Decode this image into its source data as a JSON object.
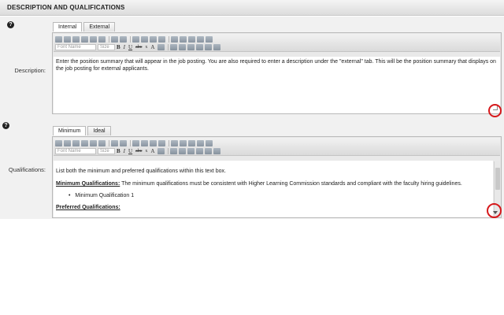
{
  "section": {
    "title": "DESCRIPTION AND QUALIFICATIONS"
  },
  "description": {
    "label": "Description:",
    "help": "?",
    "tabs": [
      "Internal",
      "External"
    ],
    "text": "Enter the position summary that will appear in the job posting. You are also required to enter a description under the \"external\" tab. This will be the position summary that displays on the job posting for external applicants."
  },
  "qualifications": {
    "label": "Qualifications:",
    "help": "?",
    "tabs": [
      "Minimum",
      "Ideal"
    ],
    "intro": "List both the minimum and preferred qualifications within this text box.",
    "min_heading": "Minimum Qualifications:",
    "min_text": "The minimum qualifications must be consistent with Higher Learning Commission standards and compliant with the faculty hiring guidelines.",
    "min_item": "Minimum Qualification 1",
    "pref_heading": "Preferred Qualifications:"
  },
  "toolbar": {
    "font_name": "Font Name",
    "size": "Size",
    "bold": "B",
    "italic": "I",
    "underline": "U",
    "strike": "abc",
    "sub": "x",
    "color": "A"
  },
  "colors": {
    "highlight_circle": "#d6191c"
  }
}
